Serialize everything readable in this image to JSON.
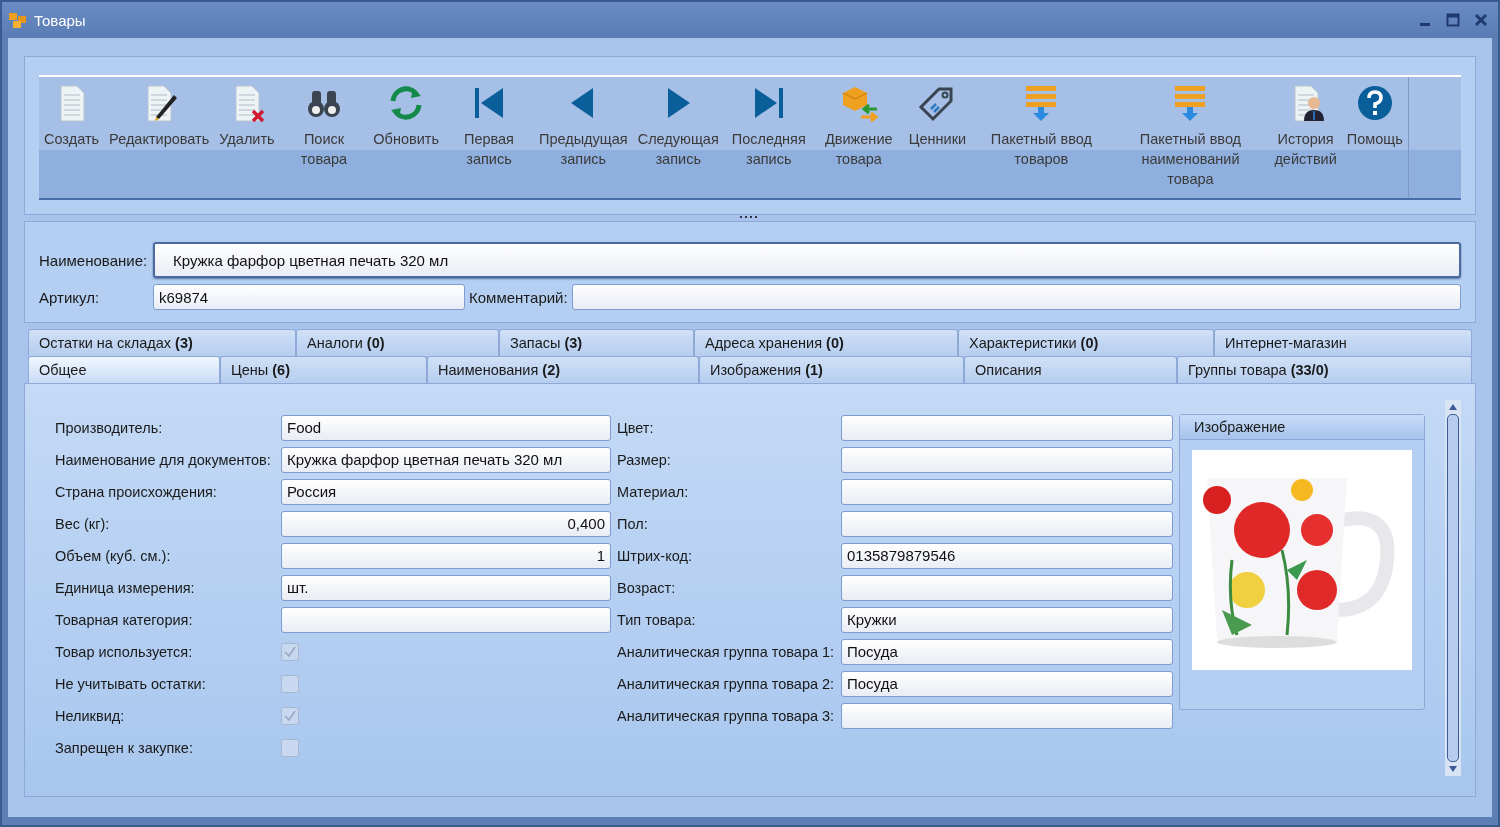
{
  "window": {
    "title": "Товары"
  },
  "toolbar": [
    {
      "kind": "create",
      "label": "Создать"
    },
    {
      "kind": "edit",
      "label": "Редактировать"
    },
    {
      "kind": "delete",
      "label": "Удалить"
    },
    {
      "kind": "search",
      "label": "Поиск товара"
    },
    {
      "kind": "refresh",
      "label": "Обновить"
    },
    {
      "kind": "first",
      "label": "Первая запись"
    },
    {
      "kind": "prev",
      "label": "Предыдущая запись"
    },
    {
      "kind": "next",
      "label": "Следующая запись"
    },
    {
      "kind": "last",
      "label": "Последняя запись"
    },
    {
      "kind": "move",
      "label": "Движение товара"
    },
    {
      "kind": "tag",
      "label": "Ценники"
    },
    {
      "kind": "batch",
      "label": "Пакетный ввод товаров"
    },
    {
      "kind": "batch",
      "label": "Пакетный ввод наименований товара"
    },
    {
      "kind": "history",
      "label": "История действий"
    },
    {
      "kind": "help",
      "label": "Помощь"
    }
  ],
  "header": {
    "name": {
      "label": "Наименование:",
      "value": "Кружка фарфор цветная печать 320 мл"
    },
    "article": {
      "label": "Артикул:",
      "value": "k69874"
    },
    "comment": {
      "label": "Комментарий:"
    }
  },
  "tabs": [
    [
      {
        "label": "Остатки на складах **(3)**",
        "selected": false
      },
      {
        "label": "Аналоги **(0)**",
        "selected": false
      },
      {
        "label": "Запасы **(3)**",
        "selected": false
      },
      {
        "label": "Адреса хранения **(0)**",
        "selected": false
      },
      {
        "label": "Характеристики **(0)**",
        "selected": false
      },
      {
        "label": "Интернет-магазин",
        "selected": false
      }
    ],
    [
      {
        "label": "Общее",
        "selected": true
      },
      {
        "label": "Цены **(6)**",
        "selected": false
      },
      {
        "label": "Наименования **(2)**",
        "selected": false
      },
      {
        "label": "Изображения **(1)**",
        "selected": false
      },
      {
        "label": "Описания",
        "selected": false
      },
      {
        "label": "Группы товара **(33/0)**",
        "selected": false
      }
    ]
  ],
  "left_fields": [
    {
      "kind": "text",
      "label": "Производитель:",
      "value": "Food"
    },
    {
      "kind": "text",
      "label": "Наименование для документов:",
      "value": "Кружка фарфор цветная печать 320 мл"
    },
    {
      "kind": "text",
      "label": "Страна происхождения:",
      "value": "Россия"
    },
    {
      "kind": "number",
      "label": "Вес (кг):",
      "value": "0,400"
    },
    {
      "kind": "number",
      "label": "Объем (куб. см.):",
      "value": "1"
    },
    {
      "kind": "text",
      "label": "Единица измерения:",
      "value": "шт."
    },
    {
      "kind": "text",
      "label": "Товарная категория:"
    },
    {
      "kind": "checkbox",
      "label": "Товар используется:",
      "checked": true
    },
    {
      "kind": "checkbox",
      "label": "Не учитывать остатки:",
      "checked": false
    },
    {
      "kind": "checkbox",
      "label": "Неликвид:",
      "checked": true
    },
    {
      "kind": "checkbox",
      "label": "Запрещен к закупке:",
      "checked": false
    }
  ],
  "right_fields": [
    {
      "label": "Цвет:"
    },
    {
      "label": "Размер:"
    },
    {
      "label": "Материал:"
    },
    {
      "label": "Пол:"
    },
    {
      "label": "Штрих-код:",
      "value": "0135879879546"
    },
    {
      "label": "Возраст:"
    },
    {
      "label": "Тип товара:",
      "value": "Кружки"
    },
    {
      "label": "Аналитическая группа товара 1:",
      "value": "Посуда"
    },
    {
      "label": "Аналитическая группа товара 2:",
      "value": "Посуда"
    },
    {
      "label": "Аналитическая группа товара 3:"
    }
  ],
  "image_panel": {
    "title": "Изображение",
    "kind": "picture"
  }
}
